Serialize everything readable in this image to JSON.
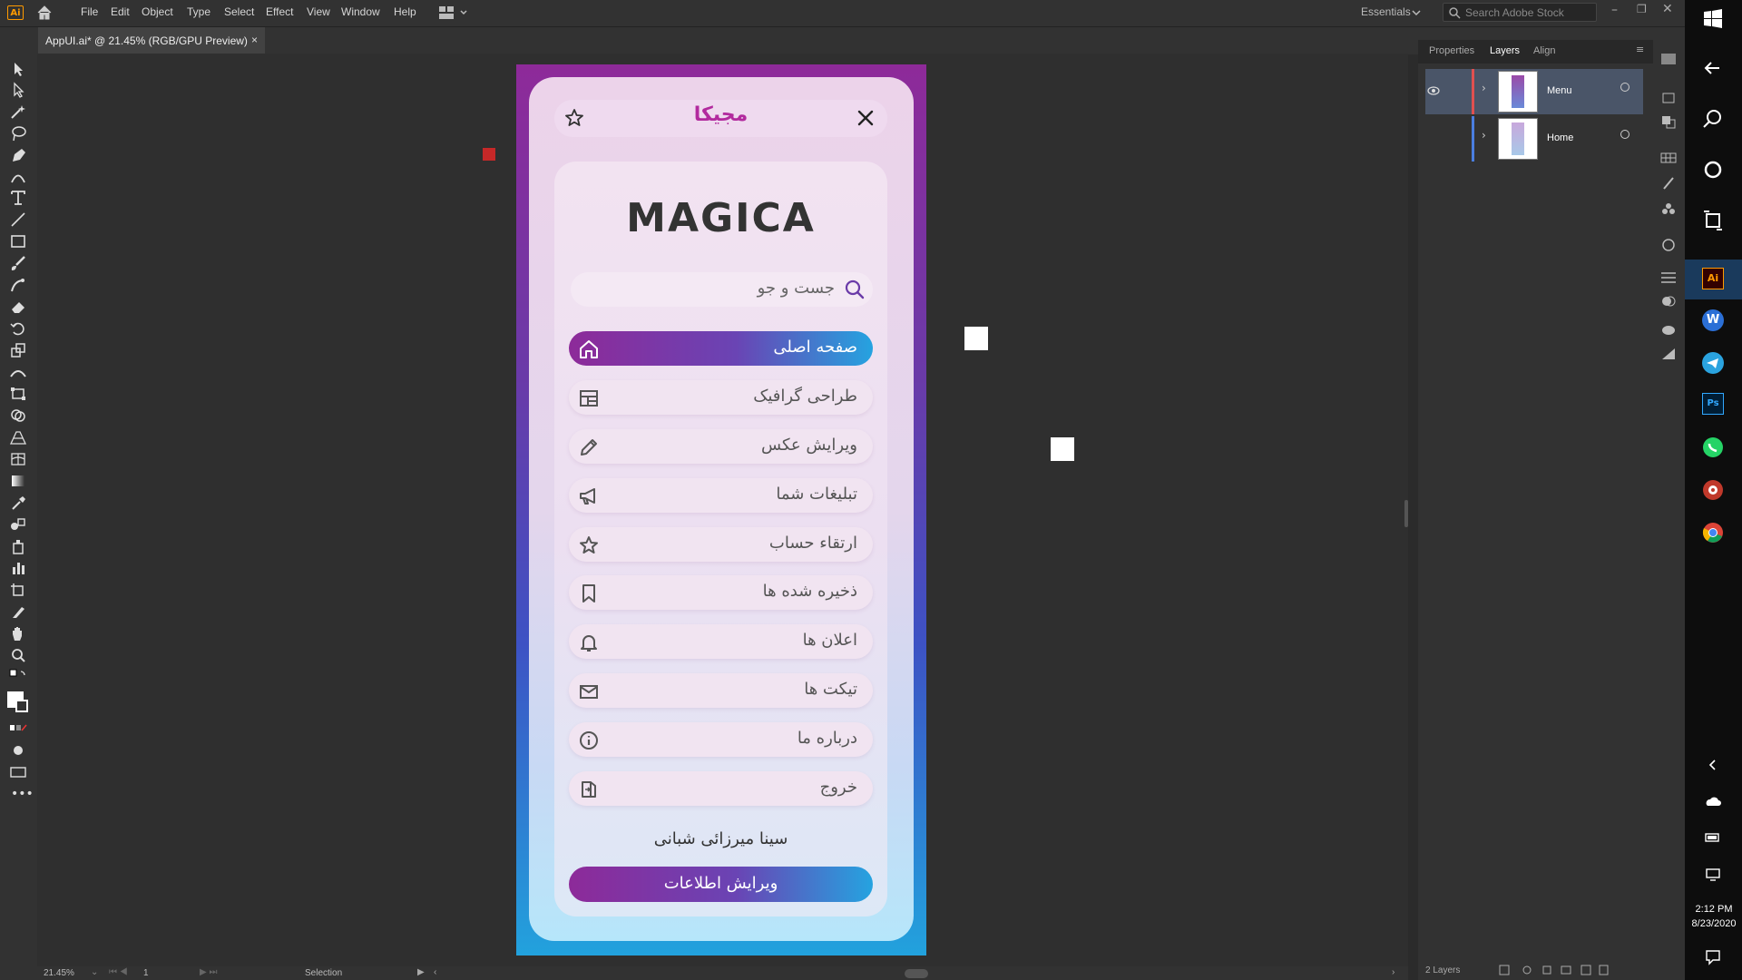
{
  "app": {
    "logo_text": "Ai",
    "menu": [
      "File",
      "Edit",
      "Object",
      "Type",
      "Select",
      "Effect",
      "View",
      "Window",
      "Help"
    ],
    "workspace": "Essentials",
    "search_placeholder": "Search Adobe Stock"
  },
  "document": {
    "tab_title": "AppUI.ai* @ 21.45% (RGB/GPU Preview)",
    "close_glyph": "×"
  },
  "status": {
    "zoom": "21.45%",
    "artboard": "1",
    "tool": "Selection"
  },
  "panel": {
    "tabs": [
      "Properties",
      "Layers",
      "Align"
    ],
    "active_tab": "Layers",
    "layers": [
      {
        "name": "Menu",
        "color": "#e05050"
      },
      {
        "name": "Home",
        "color": "#4a7ee0"
      }
    ],
    "layer_count": "2 Layers"
  },
  "taskbar": {
    "time": "2:12 PM",
    "date": "8/23/2020"
  },
  "mockup": {
    "header_logo": "مجیکا",
    "brand": "MAGICA",
    "search_placeholder": "جست و جو",
    "menu_items": [
      {
        "label": "صفحه اصلی",
        "icon": "home-icon",
        "active": true
      },
      {
        "label": "طراحی گرافیک",
        "icon": "layout-icon",
        "active": false
      },
      {
        "label": "ویرایش عکس",
        "icon": "pencil-icon",
        "active": false
      },
      {
        "label": "تبلیغات شما",
        "icon": "megaphone-icon",
        "active": false
      },
      {
        "label": "ارتقاء حساب",
        "icon": "star-icon",
        "active": false
      },
      {
        "label": "ذخیره شده ها",
        "icon": "bookmark-icon",
        "active": false
      },
      {
        "label": "اعلان ها",
        "icon": "bell-icon",
        "active": false
      },
      {
        "label": "تیکت ها",
        "icon": "mail-icon",
        "active": false
      },
      {
        "label": "درباره ما",
        "icon": "info-icon",
        "active": false
      },
      {
        "label": "خروج",
        "icon": "logout-icon",
        "active": false
      }
    ],
    "user_name": "سینا میرزائی شبانی",
    "edit_button": "ویرایش اطلاعات",
    "colors": {
      "purple": "#8d2a99",
      "blue": "#25a3e0"
    }
  }
}
